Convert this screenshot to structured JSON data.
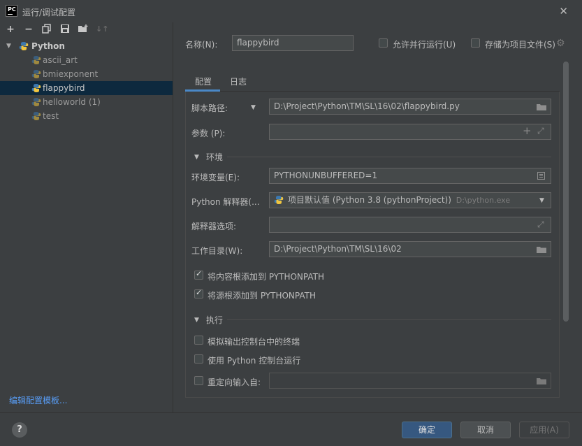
{
  "window": {
    "title": "运行/调试配置",
    "app_badge": "PC"
  },
  "toolbar": {
    "icons": [
      "plus-icon",
      "minus-icon",
      "copy-icon",
      "save-icon",
      "folder-add-icon",
      "sort-icon"
    ]
  },
  "tree": {
    "group": "Python",
    "items": [
      "ascii_art",
      "bmiexponent",
      "flappybird",
      "helloworld (1)",
      "test"
    ],
    "selected": "flappybird"
  },
  "sidebar": {
    "edit_templates": "编辑配置模板..."
  },
  "header": {
    "name_label": "名称(N):",
    "name_value": "flappybird",
    "allow_parallel": "允许并行运行(U)",
    "store_as_file": "存储为项目文件(S)"
  },
  "tabs": [
    "配置",
    "日志"
  ],
  "config": {
    "script_path_label": "脚本路径:",
    "script_path_value": "D:\\Project\\Python\\TM\\SL\\16\\02\\flappybird.py",
    "params_label": "参数 (P):",
    "params_value": "",
    "env_section": "环境",
    "env_vars_label": "环境变量(E):",
    "env_vars_value": "PYTHONUNBUFFERED=1",
    "interpreter_label": "Python 解释器(...",
    "interpreter_value": "项目默认值 (Python 3.8 (pythonProject))",
    "interpreter_path": "D:\\python.exe",
    "interp_options_label": "解释器选项:",
    "interp_options_value": "",
    "workdir_label": "工作目录(W):",
    "workdir_value": "D:\\Project\\Python\\TM\\SL\\16\\02",
    "add_content_roots": "将内容根添加到 PYTHONPATH",
    "add_source_roots": "将源根添加到 PYTHONPATH",
    "exec_section": "执行",
    "emulate_terminal": "模拟输出控制台中的终端",
    "run_with_console": "使用 Python 控制台运行",
    "redirect_input": "重定向输入自:",
    "redirect_input_value": ""
  },
  "buttons": {
    "ok": "确定",
    "cancel": "取消",
    "apply": "应用(A)",
    "help": "?"
  }
}
